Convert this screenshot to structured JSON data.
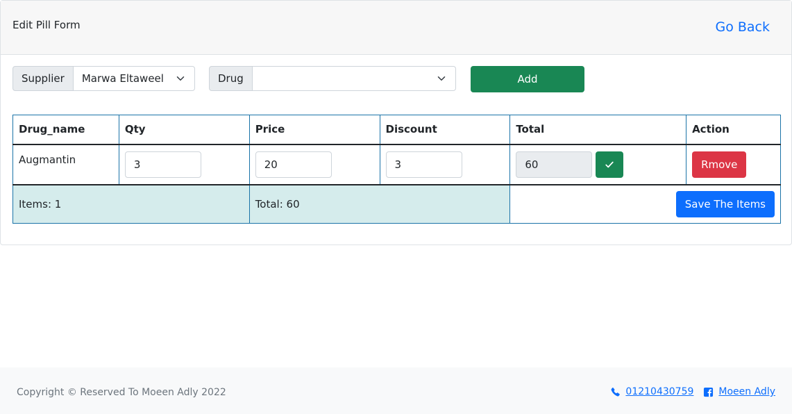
{
  "header": {
    "title": "Edit Pill Form",
    "go_back": "Go Back"
  },
  "filters": {
    "supplier_label": "Supplier",
    "supplier_value": "Marwa Eltaweel",
    "drug_label": "Drug",
    "drug_value": "",
    "add_button": "Add"
  },
  "table": {
    "columns": [
      "Drug_name",
      "Qty",
      "Price",
      "Discount",
      "Total",
      "Action"
    ],
    "rows": [
      {
        "drug_name": "Augmantin",
        "qty": "3",
        "price": "20",
        "discount": "3",
        "total": "60",
        "action": "Rmove"
      }
    ],
    "footer": {
      "items": "Items: 1",
      "total": "Total: 60",
      "save_button": "Save The Items"
    }
  },
  "footer": {
    "copyright": "Copyright © Reserved To Moeen Adly 2022",
    "phone": "01210430759",
    "facebook": "Moeen Adly"
  },
  "colors": {
    "primary": "#0d6efd",
    "success": "#198754",
    "danger": "#dc3545",
    "info_bg": "#d5ecec"
  },
  "icons": [
    "chevron-down-icon",
    "check-icon",
    "phone-icon",
    "facebook-icon"
  ]
}
